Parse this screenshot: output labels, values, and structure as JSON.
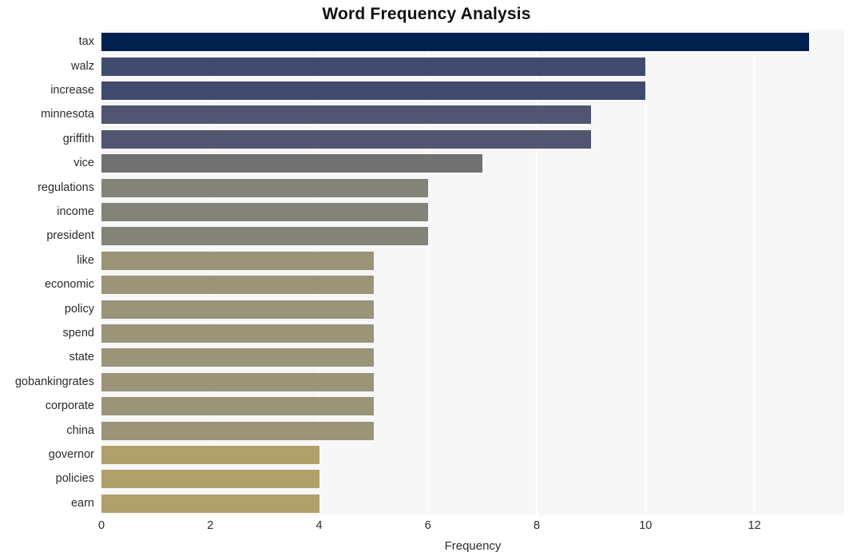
{
  "chart_data": {
    "type": "bar",
    "orientation": "horizontal",
    "title": "Word Frequency Analysis",
    "xlabel": "Frequency",
    "ylabel": "",
    "categories": [
      "tax",
      "walz",
      "increase",
      "minnesota",
      "griffith",
      "vice",
      "regulations",
      "income",
      "president",
      "like",
      "economic",
      "policy",
      "spend",
      "state",
      "gobankingrates",
      "corporate",
      "china",
      "governor",
      "policies",
      "earn"
    ],
    "values": [
      13,
      10,
      10,
      9,
      9,
      7,
      6,
      6,
      6,
      5,
      5,
      5,
      5,
      5,
      5,
      5,
      5,
      4,
      4,
      4
    ],
    "bar_colors": [
      "#00214d",
      "#3f4a6e",
      "#3f4a6e",
      "#515571",
      "#515571",
      "#717171",
      "#848378",
      "#848378",
      "#848378",
      "#9a9478",
      "#9a9478",
      "#9a9478",
      "#9a9478",
      "#9a9478",
      "#9a9478",
      "#9a9478",
      "#9a9478",
      "#aea16c",
      "#aea16c",
      "#aea16c"
    ],
    "xlim": [
      0,
      13.65
    ],
    "xticks": [
      0,
      2,
      4,
      6,
      8,
      10,
      12
    ],
    "xtick_labels": [
      "0",
      "2",
      "4",
      "6",
      "8",
      "10",
      "12"
    ],
    "grid": "vertical-white",
    "legend": null,
    "plot_background": "#f7f7f7",
    "figure_background": "#ffffff"
  }
}
